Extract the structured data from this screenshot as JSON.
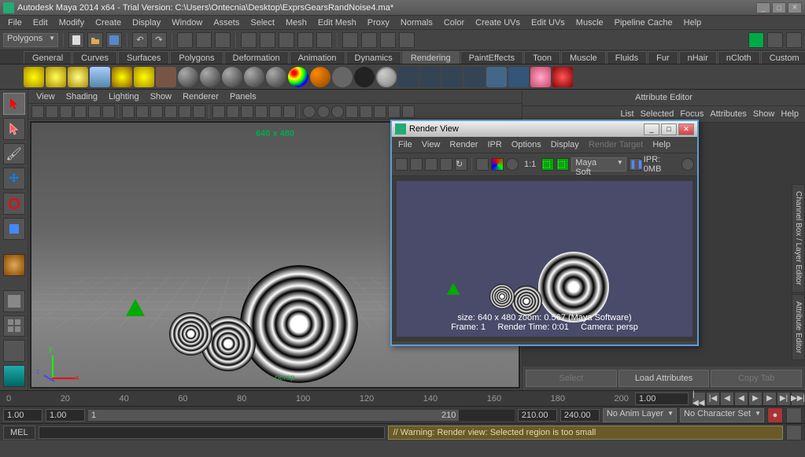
{
  "window": {
    "title": "Autodesk Maya 2014 x64 - Trial Version: C:\\Users\\Ontecnia\\Desktop\\ExprsGearsRandNoise4.ma*"
  },
  "mainmenu": [
    "File",
    "Edit",
    "Modify",
    "Create",
    "Display",
    "Window",
    "Assets",
    "Select",
    "Mesh",
    "Edit Mesh",
    "Proxy",
    "Normals",
    "Color",
    "Create UVs",
    "Edit UVs",
    "Muscle",
    "Pipeline Cache",
    "Help"
  ],
  "mode_dropdown": "Polygons",
  "shelftabs": [
    "General",
    "Curves",
    "Surfaces",
    "Polygons",
    "Deformation",
    "Animation",
    "Dynamics",
    "Rendering",
    "PaintEffects",
    "Toon",
    "Muscle",
    "Fluids",
    "Fur",
    "nHair",
    "nCloth",
    "Custom"
  ],
  "active_shelf": "Rendering",
  "viewmenu": [
    "View",
    "Shading",
    "Lighting",
    "Show",
    "Renderer",
    "Panels"
  ],
  "resolution_gate": "640 x 480",
  "persp_label": "persp",
  "attribute_editor": {
    "title": "Attribute Editor",
    "menu": [
      "List",
      "Selected",
      "Focus",
      "Attributes",
      "Show",
      "Help"
    ],
    "buttons": {
      "select": "Select",
      "load": "Load Attributes",
      "copy": "Copy Tab"
    }
  },
  "right_tabs": {
    "channel": "Channel Box / Layer Editor",
    "ae": "Attribute Editor"
  },
  "render_view": {
    "title": "Render View",
    "menu": [
      "File",
      "View",
      "Render",
      "IPR",
      "Options",
      "Display",
      "Render Target",
      "Help"
    ],
    "renderer_dropdown": "Maya Soft",
    "ipr_label": "IPR: 0MB",
    "ratio": "1:1",
    "info_line1": "size: 640 x 480    zoom: 0.567    (Maya Software)",
    "info_line2_frame": "Frame: 1",
    "info_line2_time": "Render Time: 0:01",
    "info_line2_cam": "Camera: persp"
  },
  "timeline": {
    "ticks": [
      "0",
      "20",
      "40",
      "60",
      "80",
      "100",
      "120",
      "140",
      "160",
      "180",
      "200"
    ],
    "start": "1.00",
    "range_start": "1.00",
    "range_cur1": "1",
    "range_cur2": "210",
    "range_end": "210.00",
    "end": "240.00",
    "anim_layer": "No Anim Layer",
    "char_set": "No Character Set",
    "cur_field": "1.00"
  },
  "cmdline": {
    "label": "MEL",
    "warning": "// Warning: Render view: Selected region is too small"
  }
}
